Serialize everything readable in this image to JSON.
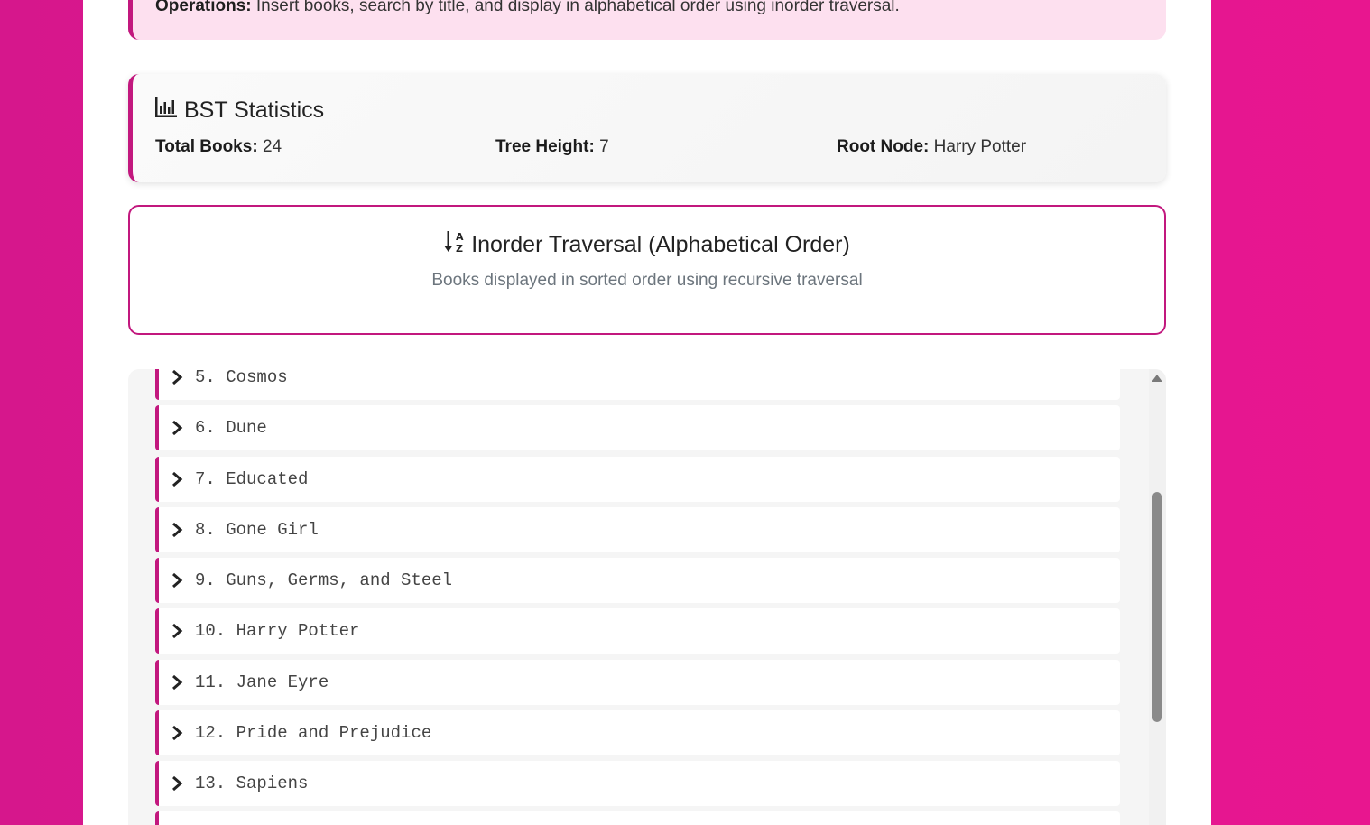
{
  "operations": {
    "label": "Operations:",
    "text": " Insert books, search by title, and display in alphabetical order using inorder traversal."
  },
  "stats": {
    "title": "BST Statistics",
    "icon": "bar-chart-icon",
    "total_books_label": "Total Books:",
    "total_books_value": "24",
    "tree_height_label": "Tree Height:",
    "tree_height_value": "7",
    "root_node_label": "Root Node:",
    "root_node_value": "Harry Potter"
  },
  "traversal": {
    "icon": "sort-alpha-down-icon",
    "title": "Inorder Traversal (Alphabetical Order)",
    "subtitle": "Books displayed in sorted order using recursive traversal"
  },
  "books": [
    "5. Cosmos",
    "6. Dune",
    "7. Educated",
    "8. Gone Girl",
    "9. Guns, Germs, and Steel",
    "10. Harry Potter",
    "11. Jane Eyre",
    "12. Pride and Prejudice",
    "13. Sapiens"
  ],
  "colors": {
    "accent": "#c2187e",
    "background": "#e01592",
    "ops_background": "#fde0ef"
  }
}
